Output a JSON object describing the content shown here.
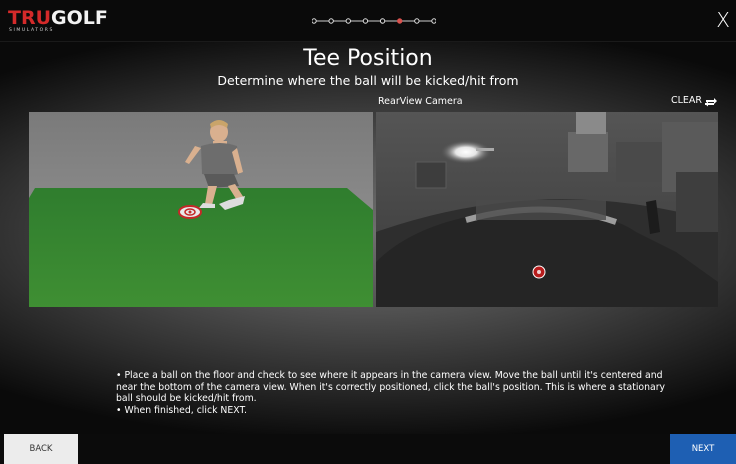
{
  "header": {
    "logo_tru": "TRU",
    "logo_golf": "GOLF",
    "logo_sub": "SIMULATORS",
    "close_label": "X",
    "steps_total": 8,
    "steps_active_index": 5,
    "accent_color": "#d9534f"
  },
  "main": {
    "title": "Tee Position",
    "subtitle": "Determine where the ball will be kicked/hit from",
    "camera_label": "RearView Camera",
    "clear_label": "CLEAR",
    "instructions": [
      "• Place a ball on the floor and check to see where it appears in the camera view. Move the ball until it's centered and near the bottom of the camera view. When it's correctly positioned, click the ball's position. This is where a stationary ball should be kicked/hit from.",
      "• When finished, click NEXT."
    ]
  },
  "footer": {
    "back_label": "BACK",
    "next_label": "NEXT",
    "next_color": "#1e5fb3"
  },
  "icons": {
    "close": "close-icon",
    "clear": "refresh-icon",
    "tee_target": "target-icon",
    "tee_marker": "target-icon"
  }
}
